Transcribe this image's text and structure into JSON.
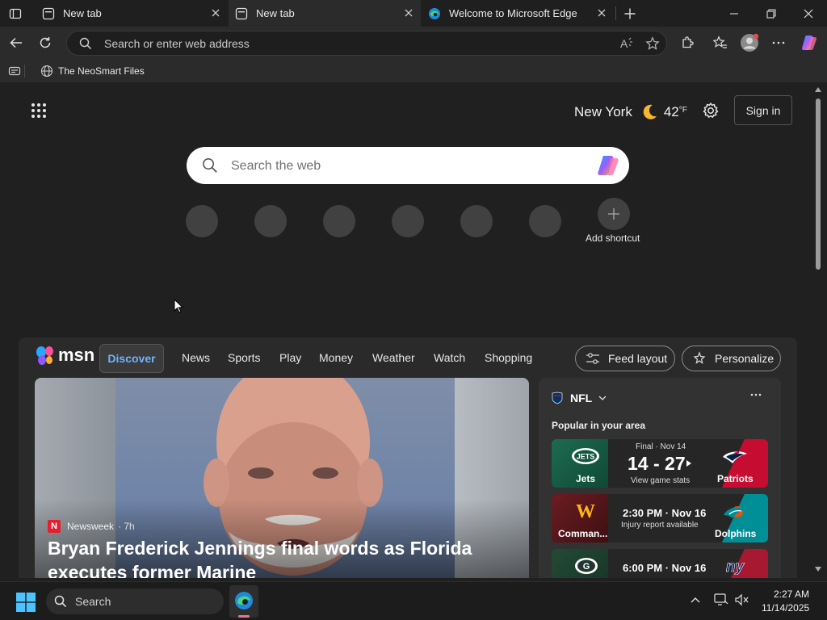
{
  "browser": {
    "tabs": [
      {
        "label": "New tab",
        "active": false
      },
      {
        "label": "New tab",
        "active": true
      },
      {
        "label": "Welcome to Microsoft Edge",
        "active": false
      }
    ],
    "address_placeholder": "Search or enter web address",
    "favorites": [
      {
        "label": "The NeoSmart Files"
      }
    ]
  },
  "ntp": {
    "weather": {
      "city": "New York",
      "temp": "42",
      "unit": "°F"
    },
    "sign_in_label": "Sign in",
    "search_placeholder": "Search the web",
    "add_shortcut_label": "Add shortcut"
  },
  "msn": {
    "logo_text": "msn",
    "nav": [
      "Discover",
      "News",
      "Sports",
      "Play",
      "Money",
      "Weather",
      "Watch",
      "Shopping"
    ],
    "feed_layout_label": "Feed layout",
    "personalize_label": "Personalize",
    "hero": {
      "source": "Newsweek",
      "age": "· 7h",
      "title": "Bryan Frederick Jennings final words as Florida executes former Marine"
    },
    "nfl": {
      "title": "NFL",
      "subtitle": "Popular in your area",
      "games": [
        {
          "status": "Final · Nov 14",
          "score": "14 - 27",
          "detail": "View game stats",
          "home": "Jets",
          "away": "Patriots"
        },
        {
          "status": "",
          "score": "2:30 PM · Nov 16",
          "detail": "Injury report available",
          "home": "Comman...",
          "away": "Dolphins"
        },
        {
          "status": "",
          "score": "6:00 PM · Nov 16",
          "detail": "",
          "home": "",
          "away": ""
        }
      ]
    }
  },
  "taskbar": {
    "search_label": "Search",
    "time": "2:27 AM",
    "date": "11/14/2025"
  },
  "colors": {
    "accent": "#6fb2ff",
    "page_bg": "#202020",
    "jets_green": "#125740",
    "patriots_red": "#c60c30",
    "dolphins_teal": "#008e97",
    "commanders_burgundy": "#5a1414"
  }
}
